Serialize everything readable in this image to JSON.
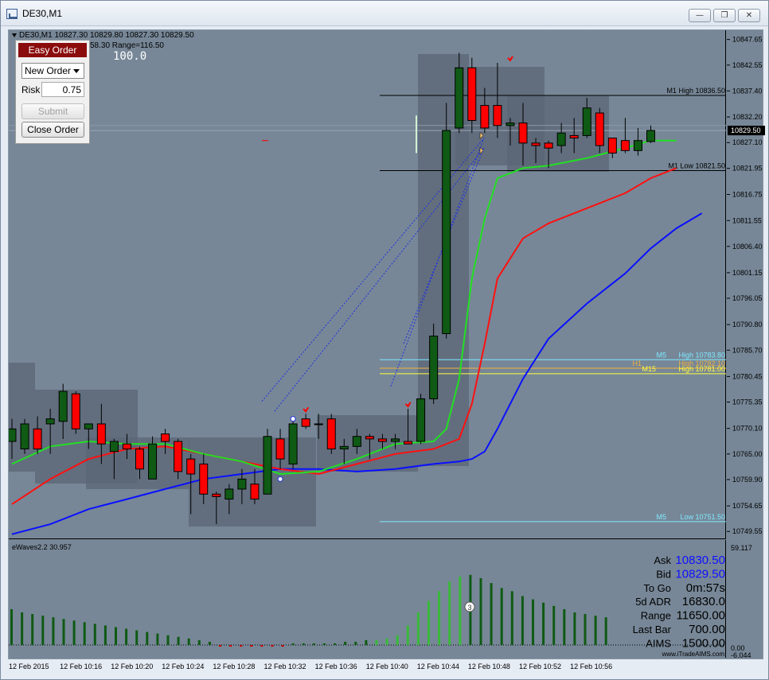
{
  "window": {
    "title": "DE30,M1"
  },
  "header": {
    "symbol_info": "DE30,M1  10827.30 10829.80 10827.30 10829.50",
    "range_info": "58.30 Range=116.50",
    "value_display": "100.0"
  },
  "easy_order": {
    "title": "Easy Order",
    "order_type": "New Order",
    "risk_label": "Risk",
    "risk_value": "0.75",
    "submit_label": "Submit",
    "close_label": "Close Order"
  },
  "price_axis": {
    "labels": [
      "10847.65",
      "10842.55",
      "10837.40",
      "10832.20",
      "10827.10",
      "10821.95",
      "10816.75",
      "10811.55",
      "10806.40",
      "10801.15",
      "10796.05",
      "10790.80",
      "10785.70",
      "10780.45",
      "10775.35",
      "10770.10",
      "10765.00",
      "10759.90",
      "10754.65",
      "10749.55"
    ],
    "current_price": "10829.50"
  },
  "level_labels": {
    "m1_high": "M1 High 10836.50",
    "m1_low": "M1 Low 10821.50",
    "m5_tag": "M5",
    "m5_high": "High 10783.80",
    "h1_tag": "H1",
    "h1_high": "High 10782.10",
    "m15_tag": "M15",
    "m15_high": "High 10781.00",
    "m5_low_tag": "M5",
    "m5_low": "Low 10751.50"
  },
  "colors": {
    "background": "#778797",
    "bull": "#0f5a14",
    "bear": "#ff0000",
    "ma_fast": "#22e022",
    "ma_mid": "#ff1010",
    "ma_slow": "#0a10ff",
    "m5_line": "#7fe8ff",
    "h1_line": "#f0b040",
    "m15_line": "#ffff40"
  },
  "sub_window": {
    "title": "eWaves2.2 30.957",
    "scale_top": "59.117",
    "scale_zero": "0.00",
    "scale_bottom": "-6.044",
    "wave_count": "3"
  },
  "info_panel": {
    "ask_label": "Ask",
    "ask_value": "10830.50",
    "bid_label": "Bid",
    "bid_value": "10829.50",
    "togo_label": "To Go",
    "togo_value": "0m:57s",
    "adr_label": "5d ADR",
    "adr_value": "16830.0",
    "range_label": "Range",
    "range_value": "11650.00",
    "lastbar_label": "Last Bar",
    "lastbar_value": "700.00",
    "aims_label": "AIMS",
    "aims_value": "1500.00",
    "website": "www.iTradeAIMS.com"
  },
  "time_axis": {
    "labels": [
      "12 Feb 2015",
      "12 Feb 10:16",
      "12 Feb 10:20",
      "12 Feb 10:24",
      "12 Feb 10:28",
      "12 Feb 10:32",
      "12 Feb 10:36",
      "12 Feb 10:40",
      "12 Feb 10:44",
      "12 Feb 10:48",
      "12 Feb 10:52",
      "12 Feb 10:56"
    ]
  },
  "chart_data": {
    "type": "candlestick",
    "symbol": "DE30",
    "timeframe": "M1",
    "ylim": [
      10748.0,
      10849.5
    ],
    "x_labels": [
      "12 Feb 2015",
      "12 Feb 10:16",
      "12 Feb 10:20",
      "12 Feb 10:24",
      "12 Feb 10:28",
      "12 Feb 10:32",
      "12 Feb 10:36",
      "12 Feb 10:40",
      "12 Feb 10:44",
      "12 Feb 10:48",
      "12 Feb 10:52",
      "12 Feb 10:56"
    ],
    "candles": [
      {
        "o": 10767.5,
        "h": 10772.0,
        "l": 10764.0,
        "c": 10770.0
      },
      {
        "o": 10766.0,
        "h": 10772.0,
        "l": 10765.0,
        "c": 10771.0
      },
      {
        "o": 10770.0,
        "h": 10772.5,
        "l": 10765.0,
        "c": 10766.0
      },
      {
        "o": 10771.0,
        "h": 10774.0,
        "l": 10765.0,
        "c": 10772.0
      },
      {
        "o": 10771.5,
        "h": 10779.0,
        "l": 10768.0,
        "c": 10777.5
      },
      {
        "o": 10777.0,
        "h": 10777.5,
        "l": 10769.0,
        "c": 10770.0
      },
      {
        "o": 10770.0,
        "h": 10771.0,
        "l": 10766.0,
        "c": 10771.0
      },
      {
        "o": 10771.0,
        "h": 10775.0,
        "l": 10763.0,
        "c": 10767.0
      },
      {
        "o": 10765.5,
        "h": 10768.0,
        "l": 10760.0,
        "c": 10767.5
      },
      {
        "o": 10767.0,
        "h": 10769.0,
        "l": 10764.0,
        "c": 10766.0
      },
      {
        "o": 10766.0,
        "h": 10766.5,
        "l": 10760.0,
        "c": 10762.0
      },
      {
        "o": 10760.0,
        "h": 10768.5,
        "l": 10760.0,
        "c": 10767.0
      },
      {
        "o": 10769.0,
        "h": 10770.0,
        "l": 10765.0,
        "c": 10767.5
      },
      {
        "o": 10767.5,
        "h": 10768.0,
        "l": 10760.0,
        "c": 10761.5
      },
      {
        "o": 10764.0,
        "h": 10765.0,
        "l": 10753.0,
        "c": 10761.0
      },
      {
        "o": 10763.0,
        "h": 10765.0,
        "l": 10755.0,
        "c": 10757.0
      },
      {
        "o": 10757.0,
        "h": 10757.5,
        "l": 10751.0,
        "c": 10756.5
      },
      {
        "o": 10756.0,
        "h": 10759.0,
        "l": 10753.0,
        "c": 10758.0
      },
      {
        "o": 10758.0,
        "h": 10762.0,
        "l": 10755.0,
        "c": 10760.0
      },
      {
        "o": 10759.0,
        "h": 10762.0,
        "l": 10755.0,
        "c": 10756.0
      },
      {
        "o": 10757.0,
        "h": 10770.0,
        "l": 10757.0,
        "c": 10768.5
      },
      {
        "o": 10768.0,
        "h": 10770.0,
        "l": 10762.0,
        "c": 10764.0
      },
      {
        "o": 10763.0,
        "h": 10772.0,
        "l": 10762.0,
        "c": 10771.0
      },
      {
        "o": 10772.0,
        "h": 10773.0,
        "l": 10770.0,
        "c": 10770.5
      },
      {
        "o": 10771.0,
        "h": 10773.0,
        "l": 10768.0,
        "c": 10771.0
      },
      {
        "o": 10772.0,
        "h": 10773.0,
        "l": 10765.0,
        "c": 10766.0
      },
      {
        "o": 10766.0,
        "h": 10768.0,
        "l": 10763.0,
        "c": 10766.5
      },
      {
        "o": 10766.5,
        "h": 10770.0,
        "l": 10765.0,
        "c": 10768.5
      },
      {
        "o": 10768.5,
        "h": 10769.0,
        "l": 10764.0,
        "c": 10768.0
      },
      {
        "o": 10768.0,
        "h": 10769.0,
        "l": 10766.0,
        "c": 10767.5
      },
      {
        "o": 10767.5,
        "h": 10769.0,
        "l": 10766.0,
        "c": 10768.0
      },
      {
        "o": 10767.5,
        "h": 10774.0,
        "l": 10767.0,
        "c": 10767.0
      },
      {
        "o": 10767.5,
        "h": 10777.0,
        "l": 10767.0,
        "c": 10776.0
      },
      {
        "o": 10776.0,
        "h": 10791.0,
        "l": 10775.0,
        "c": 10788.5
      },
      {
        "o": 10789.0,
        "h": 10835.0,
        "l": 10788.0,
        "c": 10829.5
      },
      {
        "o": 10830.0,
        "h": 10845.0,
        "l": 10829.0,
        "c": 10842.0
      },
      {
        "o": 10842.0,
        "h": 10844.0,
        "l": 10829.0,
        "c": 10831.5
      },
      {
        "o": 10834.5,
        "h": 10838.0,
        "l": 10829.0,
        "c": 10830.0
      },
      {
        "o": 10834.5,
        "h": 10843.0,
        "l": 10828.0,
        "c": 10830.5
      },
      {
        "o": 10830.5,
        "h": 10832.0,
        "l": 10826.5,
        "c": 10831.0
      },
      {
        "o": 10831.0,
        "h": 10835.0,
        "l": 10822.5,
        "c": 10827.0
      },
      {
        "o": 10827.0,
        "h": 10828.0,
        "l": 10823.0,
        "c": 10826.5
      },
      {
        "o": 10827.0,
        "h": 10827.5,
        "l": 10822.0,
        "c": 10826.0
      },
      {
        "o": 10826.5,
        "h": 10831.0,
        "l": 10825.0,
        "c": 10829.0
      },
      {
        "o": 10828.5,
        "h": 10832.0,
        "l": 10825.0,
        "c": 10828.0
      },
      {
        "o": 10828.5,
        "h": 10836.0,
        "l": 10828.0,
        "c": 10834.0
      },
      {
        "o": 10833.0,
        "h": 10834.0,
        "l": 10825.0,
        "c": 10826.5
      },
      {
        "o": 10828.0,
        "h": 10828.0,
        "l": 10824.0,
        "c": 10825.0
      },
      {
        "o": 10827.5,
        "h": 10832.0,
        "l": 10825.0,
        "c": 10825.5
      },
      {
        "o": 10825.5,
        "h": 10830.0,
        "l": 10824.5,
        "c": 10827.5
      },
      {
        "o": 10827.3,
        "h": 10830.5,
        "l": 10827.0,
        "c": 10829.5
      }
    ],
    "ma_fast": [
      [
        0,
        10763
      ],
      [
        3,
        10766.5
      ],
      [
        6,
        10767.5
      ],
      [
        9,
        10767
      ],
      [
        12,
        10767
      ],
      [
        15,
        10765
      ],
      [
        18,
        10763.5
      ],
      [
        21,
        10761
      ],
      [
        24,
        10761.5
      ],
      [
        27,
        10764
      ],
      [
        30,
        10767
      ],
      [
        33,
        10767.5
      ],
      [
        34,
        10770
      ],
      [
        35,
        10780
      ],
      [
        36,
        10800
      ],
      [
        37,
        10812
      ],
      [
        38,
        10820
      ],
      [
        40,
        10822
      ],
      [
        42,
        10822.5
      ],
      [
        45,
        10824
      ],
      [
        48,
        10826
      ],
      [
        50,
        10827.5
      ],
      [
        52,
        10827.5
      ]
    ],
    "ma_mid": [
      [
        0,
        10755
      ],
      [
        3,
        10760
      ],
      [
        6,
        10764
      ],
      [
        9,
        10766
      ],
      [
        12,
        10766.5
      ],
      [
        15,
        10765
      ],
      [
        18,
        10763.5
      ],
      [
        21,
        10762
      ],
      [
        24,
        10761
      ],
      [
        27,
        10763
      ],
      [
        30,
        10765
      ],
      [
        33,
        10766
      ],
      [
        35,
        10768
      ],
      [
        36,
        10775
      ],
      [
        37,
        10787
      ],
      [
        38,
        10800
      ],
      [
        40,
        10808
      ],
      [
        42,
        10811
      ],
      [
        45,
        10814
      ],
      [
        48,
        10817
      ],
      [
        50,
        10820
      ],
      [
        52,
        10822
      ]
    ],
    "ma_slow": [
      [
        0,
        10749
      ],
      [
        3,
        10751
      ],
      [
        6,
        10754
      ],
      [
        9,
        10756
      ],
      [
        12,
        10758
      ],
      [
        15,
        10760
      ],
      [
        18,
        10761
      ],
      [
        21,
        10762
      ],
      [
        24,
        10762
      ],
      [
        27,
        10761.5
      ],
      [
        30,
        10762
      ],
      [
        33,
        10763
      ],
      [
        35,
        10763.5
      ],
      [
        36,
        10764
      ],
      [
        37,
        10765.5
      ],
      [
        38,
        10770
      ],
      [
        40,
        10780
      ],
      [
        42,
        10788
      ],
      [
        45,
        10795
      ],
      [
        48,
        10801
      ],
      [
        50,
        10806
      ],
      [
        52,
        10810
      ],
      [
        54,
        10813
      ]
    ],
    "levels": [
      {
        "name": "M1 High",
        "value": 10836.5
      },
      {
        "name": "M1 Low",
        "value": 10821.5
      },
      {
        "name": "M5 High",
        "value": 10783.8
      },
      {
        "name": "H1 High",
        "value": 10782.1
      },
      {
        "name": "M15 High",
        "value": 10781.0
      },
      {
        "name": "M5 Low",
        "value": 10751.5
      }
    ],
    "histogram": [
      22,
      20,
      19,
      18,
      17,
      16,
      15,
      14,
      13,
      12,
      11,
      10,
      9,
      8,
      7,
      6,
      5,
      4,
      3,
      2,
      -1,
      -1,
      -1,
      -1,
      -1,
      -1,
      -1,
      1,
      1,
      1,
      1,
      1,
      2,
      2,
      3,
      3,
      4,
      6,
      12,
      20,
      27,
      33,
      39,
      42,
      43,
      41,
      38,
      35,
      33,
      30,
      28,
      26,
      24,
      22,
      20,
      19,
      18,
      17
    ]
  }
}
